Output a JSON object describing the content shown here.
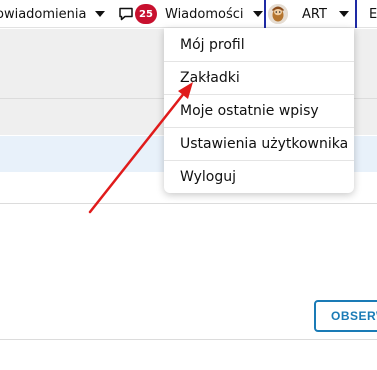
{
  "topbar": {
    "notifications_label": "owiadomienia",
    "messages_badge": "25",
    "messages_label": "Wiadomości",
    "user_name": "ART",
    "cut_label": "Ed"
  },
  "user_menu": {
    "items": [
      {
        "label": "Mój profil"
      },
      {
        "label": "Zakładki"
      },
      {
        "label": "Moje ostatnie wpisy"
      },
      {
        "label": "Ustawienia użytkownika"
      },
      {
        "label": "Wyloguj"
      }
    ]
  },
  "main": {
    "observe_button_label": "OBSERWUJ"
  },
  "colors": {
    "badge": "#c8102e",
    "accent_blue": "#1a7bb6",
    "annotation_arrow": "#e01b1b",
    "divider": "#1e2aa5"
  },
  "icons": {
    "messages": "speech-bubble-icon",
    "caret": "caret-down-icon",
    "avatar": "user-avatar"
  }
}
